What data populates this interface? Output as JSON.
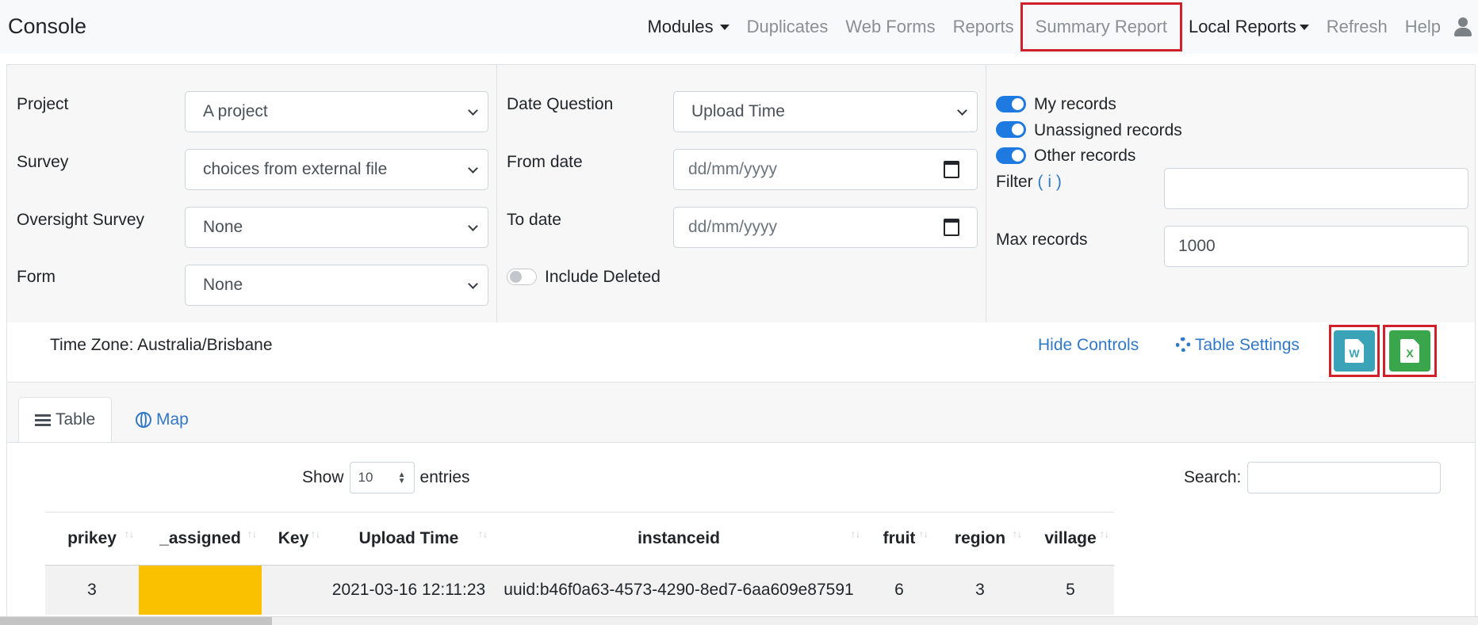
{
  "navbar": {
    "brand": "Console",
    "items": [
      {
        "label": "Modules",
        "dropdown": true,
        "dark": true
      },
      {
        "label": "Duplicates"
      },
      {
        "label": "Web Forms"
      },
      {
        "label": "Reports"
      },
      {
        "label": "Summary Report",
        "highlighted": true
      },
      {
        "label": "Local Reports",
        "dropdown": true,
        "dark": true
      },
      {
        "label": "Refresh"
      },
      {
        "label": "Help"
      }
    ],
    "user_icon": "user-icon"
  },
  "controls": {
    "project": {
      "label": "Project",
      "value": "A project"
    },
    "survey": {
      "label": "Survey",
      "value": "choices from external file"
    },
    "oversight": {
      "label": "Oversight Survey",
      "value": "None"
    },
    "form": {
      "label": "Form",
      "value": "None"
    },
    "date_question": {
      "label": "Date Question",
      "value": "Upload Time"
    },
    "from_date": {
      "label": "From date",
      "placeholder": "dd/mm/yyyy"
    },
    "to_date": {
      "label": "To date",
      "placeholder": "dd/mm/yyyy"
    },
    "include_deleted": {
      "label": "Include Deleted",
      "on": false
    },
    "my_records": {
      "label": "My records",
      "on": true
    },
    "unassigned_records": {
      "label": "Unassigned records",
      "on": true
    },
    "other_records": {
      "label": "Other records",
      "on": true
    },
    "filter": {
      "label": "Filter",
      "info": "( i )",
      "value": ""
    },
    "max_records": {
      "label": "Max records",
      "value": "1000"
    },
    "timezone": "Time Zone: Australia/Brisbane",
    "hide_controls": "Hide Controls",
    "table_settings": "Table Settings",
    "export_word": {
      "letter": "W",
      "color": "#3ba3b8"
    },
    "export_excel": {
      "letter": "X",
      "color": "#3aa64c"
    }
  },
  "tabs": [
    {
      "label": "Table",
      "active": true,
      "icon": "list-icon"
    },
    {
      "label": "Map",
      "active": false,
      "icon": "globe-icon"
    }
  ],
  "datatable": {
    "show_label": "Show",
    "page_length": "10",
    "entries_label": "entries",
    "search_label": "Search:",
    "columns": [
      "prikey",
      "_assigned",
      "Key",
      "Upload Time",
      "instanceid",
      "fruit",
      "region",
      "village"
    ],
    "rows": [
      [
        "3",
        "",
        "",
        "2021-03-16 12:11:23",
        "uuid:b46f0a63-4573-4290-8ed7-6aa609e87591",
        "6",
        "3",
        "5"
      ]
    ]
  },
  "colors": {
    "accent": "#3178c6",
    "highlight": "#d0202c",
    "assigned": "#f9c100"
  }
}
